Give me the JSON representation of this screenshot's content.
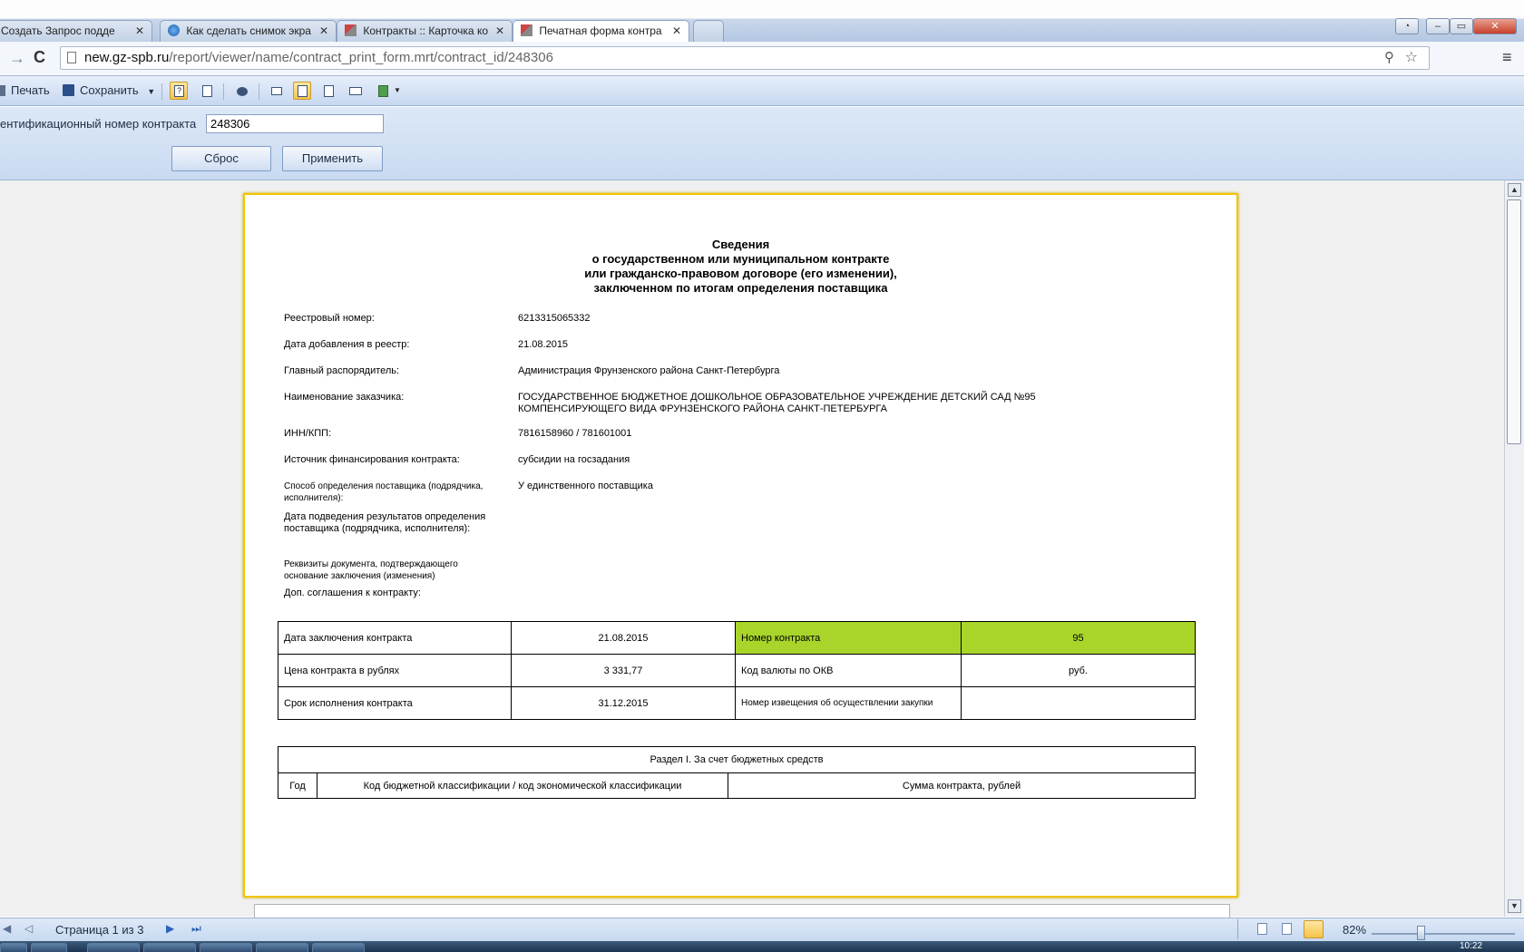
{
  "browser": {
    "tabs": [
      {
        "title": "Создать Запрос подде",
        "close": "✕"
      },
      {
        "title": "Как сделать снимок экра",
        "close": "✕"
      },
      {
        "title": "Контракты :: Карточка ко",
        "close": "✕"
      },
      {
        "title": "Печатная форма контра",
        "close": "✕"
      }
    ],
    "url_host": "new.gz-spb.ru",
    "url_path": "/report/viewer/name/contract_print_form.mrt/contract_id/248306"
  },
  "toolbar": {
    "print_label": "Печать",
    "save_label": "Сохранить"
  },
  "params": {
    "label": "ентификационный номер контракта",
    "contract_id_value": "248306",
    "reset_label": "Сброс",
    "apply_label": "Применить"
  },
  "report": {
    "title_lines": [
      "Сведения",
      "о государственном или муниципальном контракте",
      "или гражданско-правовом договоре (его изменении),",
      "заключенном по итогам определения поставщика"
    ],
    "fields": [
      {
        "label": "Реестровый номер:",
        "value": "6213315065332"
      },
      {
        "label": "Дата добавления в реестр:",
        "value": "21.08.2015"
      },
      {
        "label": "Главный распорядитель:",
        "value": "Администрация Фрунзенского района Санкт-Петербурга"
      },
      {
        "label": "Наименование заказчика:",
        "value": "ГОСУДАРСТВЕННОЕ БЮДЖЕТНОЕ ДОШКОЛЬНОЕ ОБРАЗОВАТЕЛЬНОЕ УЧРЕЖДЕНИЕ ДЕТСКИЙ САД №95 КОМПЕНСИРУЮЩЕГО ВИДА ФРУНЗЕНСКОГО РАЙОНА САНКТ-ПЕТЕРБУРГА"
      },
      {
        "label": "ИНН/КПП:",
        "value": "7816158960 / 781601001"
      },
      {
        "label": "Источник финансирования контракта:",
        "value": "субсидии на госзадания"
      },
      {
        "label": "Способ определения поставщика (подрядчика, исполнителя):",
        "value": "У единственного поставщика"
      },
      {
        "label": "Дата подведения результатов определения поставщика (подрядчика, исполнителя):",
        "value": ""
      },
      {
        "label": "Реквизиты документа, подтверждающего основание заключения (изменения)",
        "value": ""
      },
      {
        "label": "Доп. соглашения к контракту:",
        "value": ""
      }
    ],
    "summary": {
      "date_label": "Дата заключения контракта",
      "date_value": "21.08.2015",
      "number_label": "Номер контракта",
      "number_value": "95",
      "price_label": "Цена контракта в рублях",
      "price_value": "3 331,77",
      "currency_label": "Код валюты по ОКВ",
      "currency_value": "руб.",
      "term_label": "Срок исполнения контракта",
      "term_value": "31.12.2015",
      "notice_label": "Номер извещения об осуществлении закупки",
      "notice_value": ""
    },
    "section": {
      "title": "Раздел I. За счет бюджетных средств",
      "col_year": "Год",
      "col_code": "Код бюджетной классификации / код экономической классификации",
      "col_sum": "Сумма контракта, рублей"
    }
  },
  "statusbar": {
    "page_info": "Страница 1 из 3",
    "zoom": "82%"
  },
  "taskbar": {
    "clock": "10:22"
  },
  "colors": {
    "page_border": "#f4c400",
    "highlight": "#a9d52a",
    "toolbar": "#c7d8f0"
  }
}
